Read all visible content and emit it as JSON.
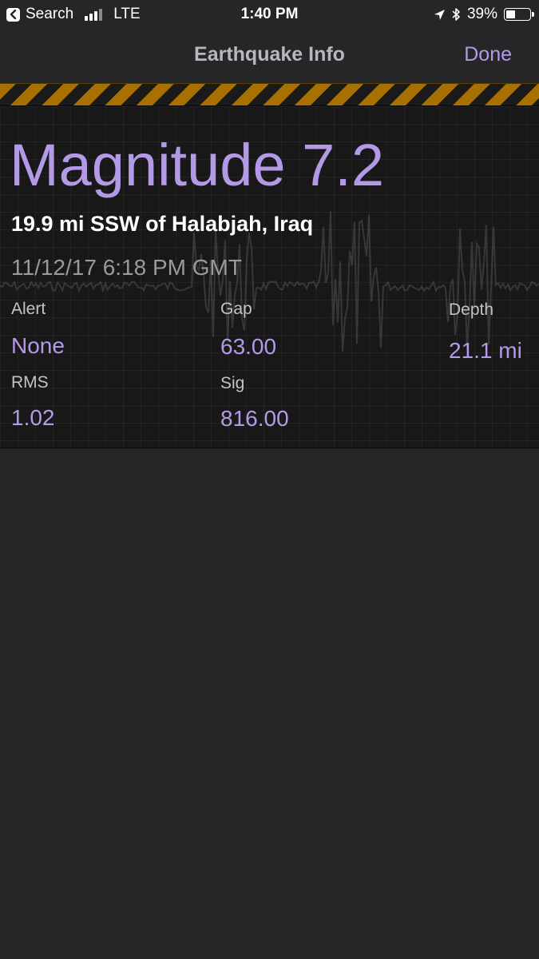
{
  "status_bar": {
    "back_label": "Search",
    "network": "LTE",
    "time": "1:40 PM",
    "battery_percent": "39%",
    "battery_level": 0.39,
    "signal_bars_on": 3,
    "signal_bars_total": 4
  },
  "nav": {
    "title": "Earthquake Info",
    "done_label": "Done"
  },
  "quake": {
    "magnitude_text": "Magnitude 7.2",
    "location": "19.9 mi SSW of Halabjah, Iraq",
    "datetime": "11/12/17 6:18 PM GMT",
    "fields": {
      "alert": {
        "label": "Alert",
        "value": "None"
      },
      "gap": {
        "label": "Gap",
        "value": "63.00"
      },
      "depth": {
        "label": "Depth",
        "value": "21.1 mi"
      },
      "rms": {
        "label": "RMS",
        "value": "1.02"
      },
      "sig": {
        "label": "Sig",
        "value": "816.00"
      }
    }
  },
  "colors": {
    "accent": "#b49ae6",
    "background": "#262628",
    "hazard_orange": "#a87000"
  },
  "icons": [
    "back-arrow-icon",
    "signal-bars-icon",
    "location-arrow-icon",
    "bluetooth-icon",
    "battery-icon"
  ]
}
